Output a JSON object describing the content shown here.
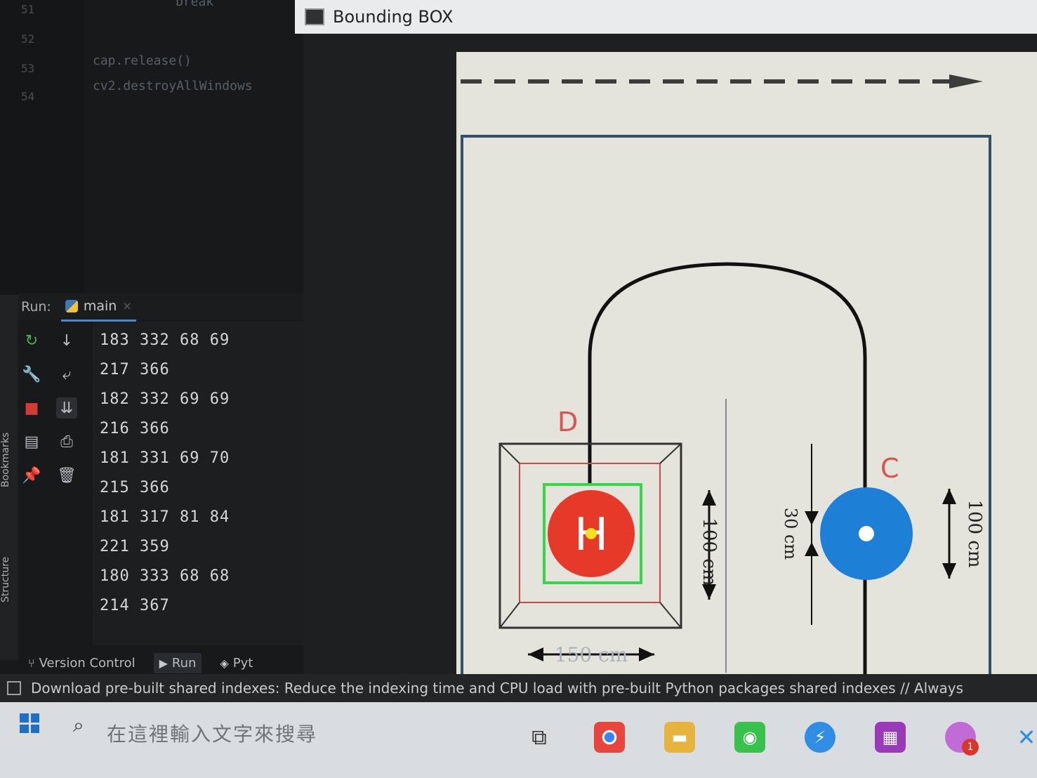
{
  "editor": {
    "line_numbers": [
      "51",
      "52",
      "53",
      "54"
    ],
    "code_lines": [
      "break",
      "cap.release()",
      "cv2.destroyAllWindows"
    ]
  },
  "side_labels": {
    "bookmarks": "Bookmarks",
    "structure": "Structure"
  },
  "run_panel": {
    "label": "Run:",
    "tab": "main",
    "output": [
      "183 332 68 69",
      "217 366",
      "182 332 69 69",
      "216 366",
      "181 331 69 70",
      "215 366",
      "181 317 81 84",
      "221 359",
      "180 333 68 68",
      "214 367"
    ]
  },
  "bottom_tabs": {
    "version_control": "Version Control",
    "run": "Run",
    "python": "Pyt"
  },
  "status_bar": {
    "message": "Download pre-built shared indexes: Reduce the indexing time and CPU load with pre-built Python packages shared indexes // Always"
  },
  "window": {
    "title": "Bounding BOX"
  },
  "diagram": {
    "label_d": "D",
    "label_c": "C",
    "dim_150": "150 cm",
    "dim_100_left": "100 cm",
    "dim_30": "30 cm",
    "dim_100_right": "100 cm",
    "helipad_letter": "H"
  },
  "taskbar": {
    "search_placeholder": "在這裡輸入文字來搜尋",
    "notification_count": "1"
  },
  "colors": {
    "bbox_green": "#35d64a",
    "helipad_red": "#e5392a",
    "target_blue": "#1d7fd6",
    "center_yellow": "#f4e21a"
  }
}
